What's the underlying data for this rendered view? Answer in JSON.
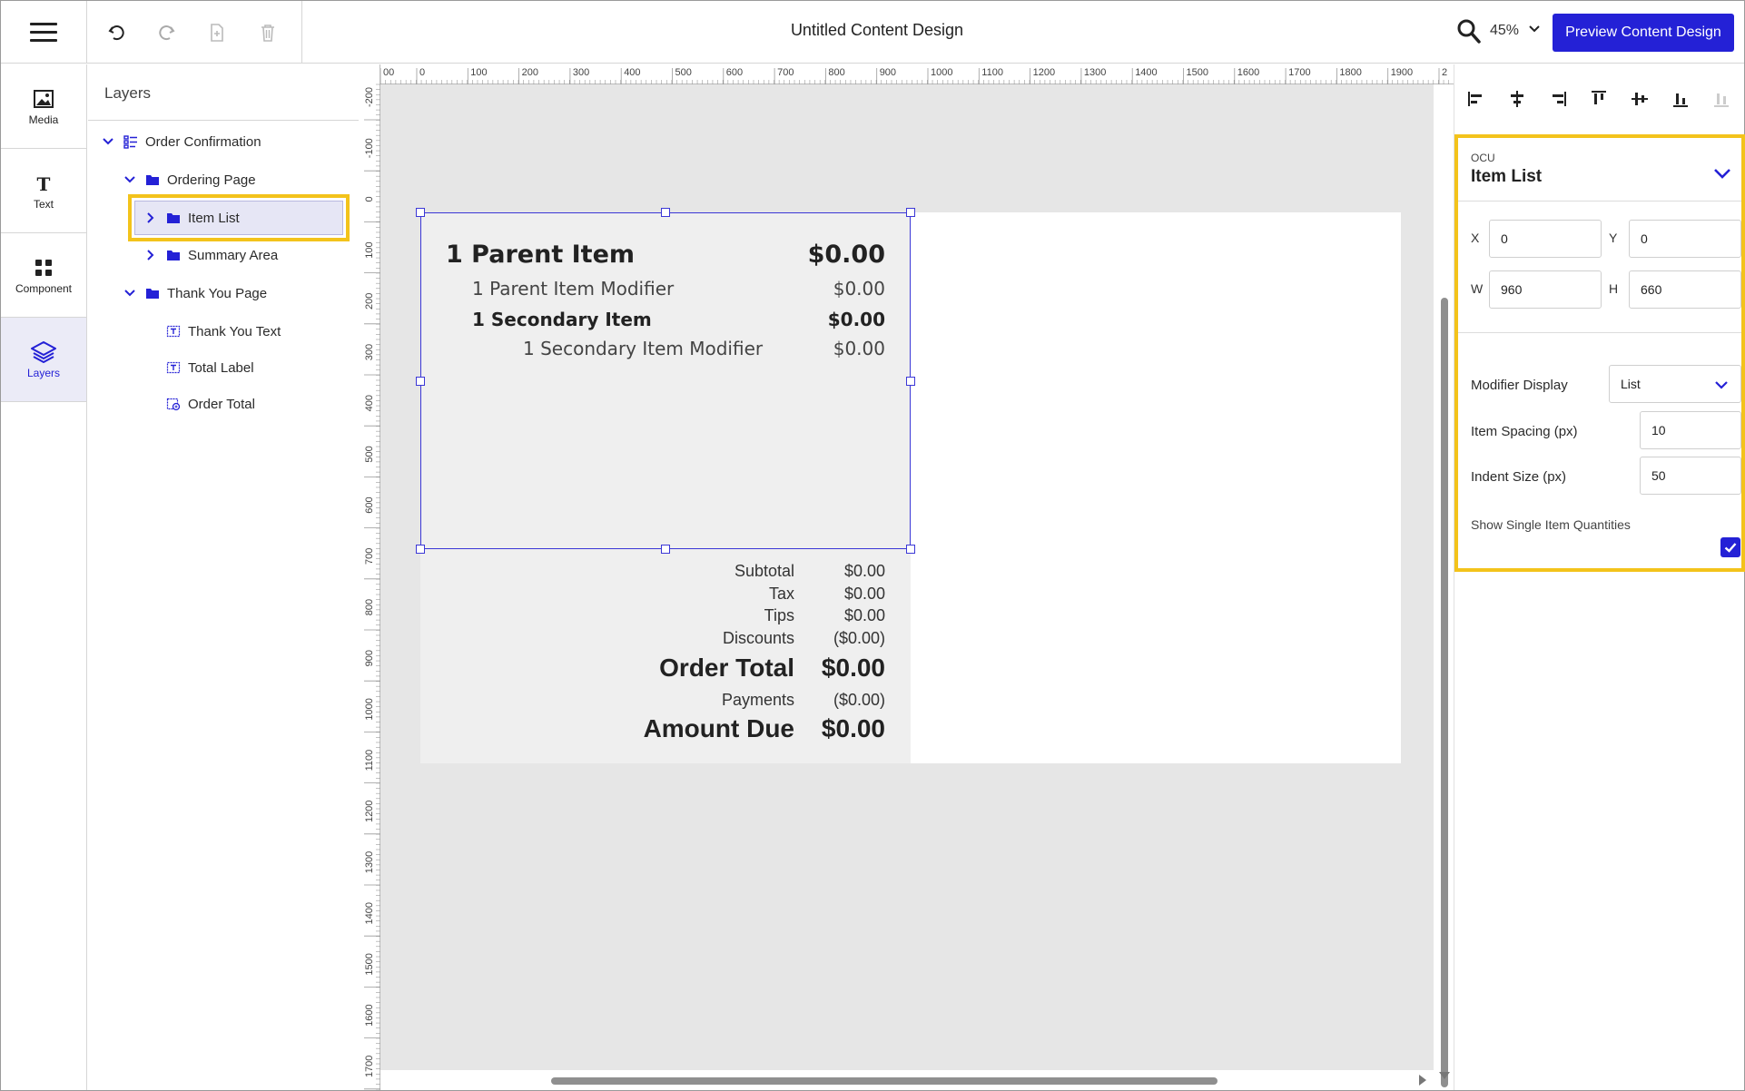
{
  "header": {
    "title": "Untitled Content Design",
    "zoom": "45%",
    "preview_label": "Preview Content Design"
  },
  "rail": {
    "items": [
      {
        "label": "Media",
        "icon": "image-icon"
      },
      {
        "label": "Text",
        "icon": "text-icon"
      },
      {
        "label": "Component",
        "icon": "grid-icon"
      },
      {
        "label": "Layers",
        "icon": "layers-icon",
        "active": true
      }
    ]
  },
  "layers": {
    "title": "Layers",
    "tree": {
      "order_confirmation": "Order Confirmation",
      "ordering_page": "Ordering Page",
      "item_list": "Item List",
      "summary_area": "Summary Area",
      "thank_you_page": "Thank You Page",
      "thank_you_text": "Thank You Text",
      "total_label": "Total Label",
      "order_total": "Order Total"
    }
  },
  "rulers": {
    "horizontal": [
      "00",
      "0",
      "100",
      "200",
      "300",
      "400",
      "500",
      "600",
      "700",
      "800",
      "900",
      "1000",
      "1100",
      "1200",
      "1300",
      "1400",
      "1500",
      "1600",
      "1700",
      "1800",
      "1900",
      "2"
    ],
    "vertical": [
      "-200",
      "-100",
      "0",
      "100",
      "200",
      "300",
      "400",
      "500",
      "600",
      "700",
      "800",
      "900",
      "1000",
      "1100",
      "1200",
      "1300",
      "1400",
      "1500",
      "1600",
      "1700"
    ]
  },
  "canvas": {
    "item_list": {
      "parent_item": {
        "name": "1 Parent Item",
        "price": "$0.00"
      },
      "parent_modifier": {
        "name": "1 Parent Item Modifier",
        "price": "$0.00"
      },
      "secondary_item": {
        "name": "1 Secondary Item",
        "price": "$0.00"
      },
      "secondary_modifier": {
        "name": "1 Secondary Item Modifier",
        "price": "$0.00"
      }
    },
    "summary": {
      "subtotal": {
        "label": "Subtotal",
        "value": "$0.00"
      },
      "tax": {
        "label": "Tax",
        "value": "$0.00"
      },
      "tips": {
        "label": "Tips",
        "value": "$0.00"
      },
      "discounts": {
        "label": "Discounts",
        "value": "($0.00)"
      },
      "order_total": {
        "label": "Order Total",
        "value": "$0.00"
      },
      "payments": {
        "label": "Payments",
        "value": "($0.00)"
      },
      "amount_due": {
        "label": "Amount Due",
        "value": "$0.00"
      }
    }
  },
  "properties": {
    "subtitle": "OCU",
    "title": "Item List",
    "x_label": "X",
    "x_value": "0",
    "y_label": "Y",
    "y_value": "0",
    "w_label": "W",
    "w_value": "960",
    "h_label": "H",
    "h_value": "660",
    "modifier_display_label": "Modifier Display",
    "modifier_display_value": "List",
    "item_spacing_label": "Item Spacing (px)",
    "item_spacing_value": "10",
    "indent_size_label": "Indent Size (px)",
    "indent_size_value": "50",
    "show_single_label": "Show Single Item Quantities",
    "show_single_checked": true
  },
  "colors": {
    "accent": "#2421d6",
    "highlight": "#f3c31b",
    "canvas_bg": "#e6e6e6"
  }
}
